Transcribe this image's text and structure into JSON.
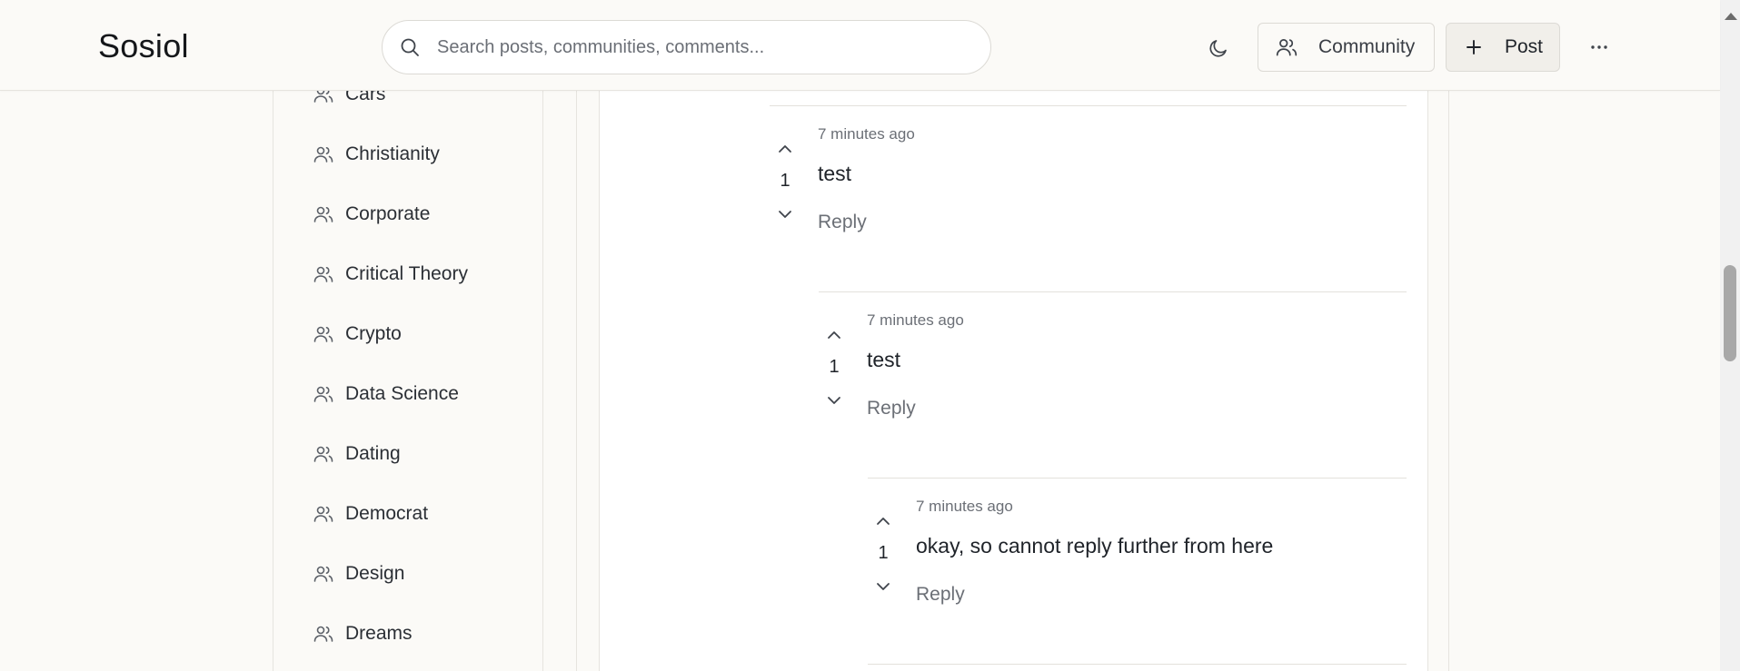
{
  "header": {
    "logo": "Sosiol",
    "search_placeholder": "Search posts, communities, comments...",
    "community_label": "Community",
    "post_label": "Post"
  },
  "sidebar": {
    "items": [
      {
        "label": "Cars"
      },
      {
        "label": "Christianity"
      },
      {
        "label": "Corporate"
      },
      {
        "label": "Critical Theory"
      },
      {
        "label": "Crypto"
      },
      {
        "label": "Data Science"
      },
      {
        "label": "Dating"
      },
      {
        "label": "Democrat"
      },
      {
        "label": "Design"
      },
      {
        "label": "Dreams"
      }
    ]
  },
  "comments": [
    {
      "time": "7 minutes ago",
      "text": "test",
      "votes": "1",
      "reply_label": "Reply"
    },
    {
      "time": "7 minutes ago",
      "text": "test",
      "votes": "1",
      "reply_label": "Reply"
    },
    {
      "time": "7 minutes ago",
      "text": "okay, so cannot reply further from here",
      "votes": "1",
      "reply_label": "Reply"
    }
  ],
  "colors": {
    "background": "#fbfaf7",
    "text": "#1f2329",
    "muted": "#6b6f76",
    "border": "#e3e1dc"
  }
}
